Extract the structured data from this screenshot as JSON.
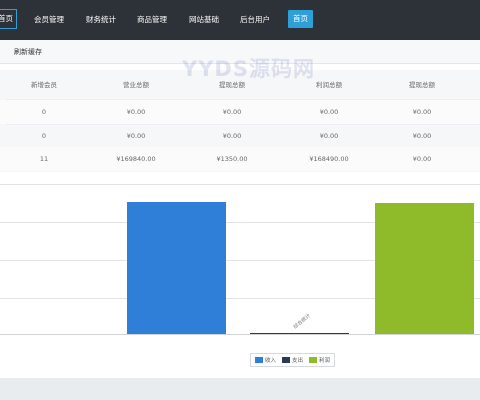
{
  "nav": {
    "items": [
      {
        "label": "首页",
        "name": "nav-item-home-active",
        "active": true
      },
      {
        "label": "会员管理",
        "name": "nav-item-members"
      },
      {
        "label": "财务统计",
        "name": "nav-item-finance"
      },
      {
        "label": "商品管理",
        "name": "nav-item-products"
      },
      {
        "label": "网站基础",
        "name": "nav-item-site"
      },
      {
        "label": "后台用户",
        "name": "nav-item-admin-users"
      }
    ],
    "home_button": "首页"
  },
  "tabs": {
    "refresh_cache": "刷新缓存"
  },
  "stats": {
    "headers": [
      "新增会员",
      "营业总额",
      "提现总额",
      "利润总额",
      "提现总额"
    ],
    "rows": [
      [
        "0",
        "¥0.00",
        "¥0.00",
        "¥0.00",
        "¥0.00"
      ],
      [
        "0",
        "¥0.00",
        "¥0.00",
        "¥0.00",
        "¥0.00"
      ],
      [
        "11",
        "¥169840.00",
        "¥1350.00",
        "¥168490.00",
        "¥0.00"
      ]
    ]
  },
  "chart_data": {
    "type": "bar",
    "categories": [
      "综合统计"
    ],
    "series": [
      {
        "name": "收入",
        "values": [
          169840
        ],
        "color": "#2f7fd8"
      },
      {
        "name": "支出",
        "values": [
          1350
        ],
        "color": "#2b3a55"
      },
      {
        "name": "利润",
        "values": [
          168490
        ],
        "color": "#8fbb2a"
      }
    ],
    "ylim": [
      0,
      190000
    ],
    "grid": true,
    "legend_position": "bottom-center"
  },
  "watermark": "YYDS源码网"
}
